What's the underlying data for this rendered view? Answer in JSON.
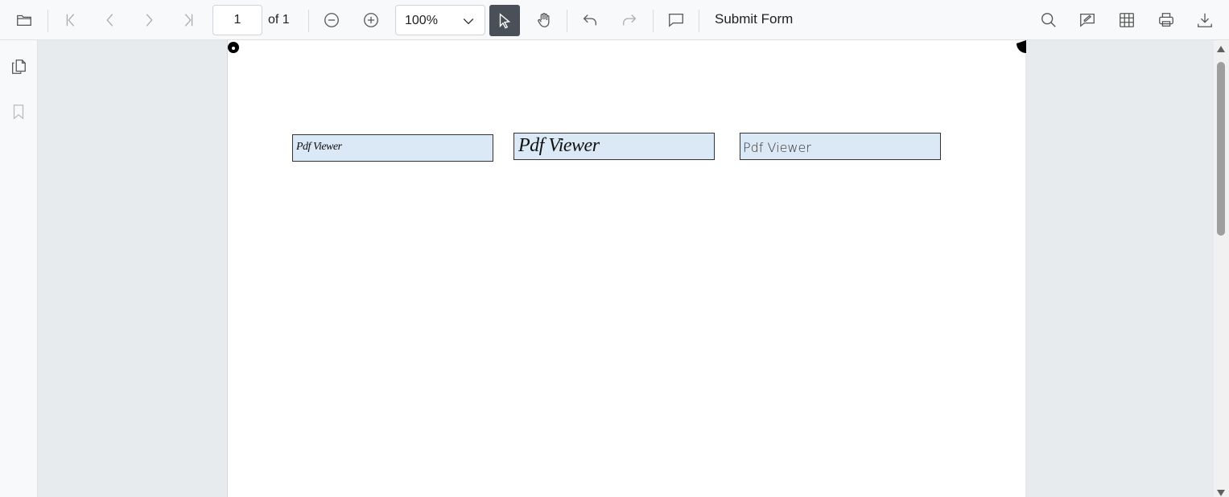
{
  "toolbar": {
    "current_page": "1",
    "total_pages_label": "of 1",
    "zoom": "100%",
    "submit_label": "Submit Form"
  },
  "document": {
    "fields": [
      {
        "value": "Pdf Viewer"
      },
      {
        "value": "Pdf Viewer"
      },
      {
        "value": "Pdf Viewer"
      }
    ]
  },
  "colors": {
    "toolbar_bg": "#f8f9fa",
    "viewer_bg": "#e8ebee",
    "active_tool_bg": "#495057",
    "field_bg": "#dbe8f5"
  },
  "icons": [
    "open-folder-icon",
    "first-page-icon",
    "previous-page-icon",
    "next-page-icon",
    "last-page-icon",
    "zoom-out-icon",
    "zoom-in-icon",
    "chevron-down-icon",
    "selection-cursor-icon",
    "pan-hand-icon",
    "undo-icon",
    "redo-icon",
    "comment-icon",
    "search-icon",
    "edit-annotation-icon",
    "form-designer-icon",
    "print-icon",
    "download-icon",
    "page-thumbnails-icon",
    "bookmarks-icon"
  ]
}
